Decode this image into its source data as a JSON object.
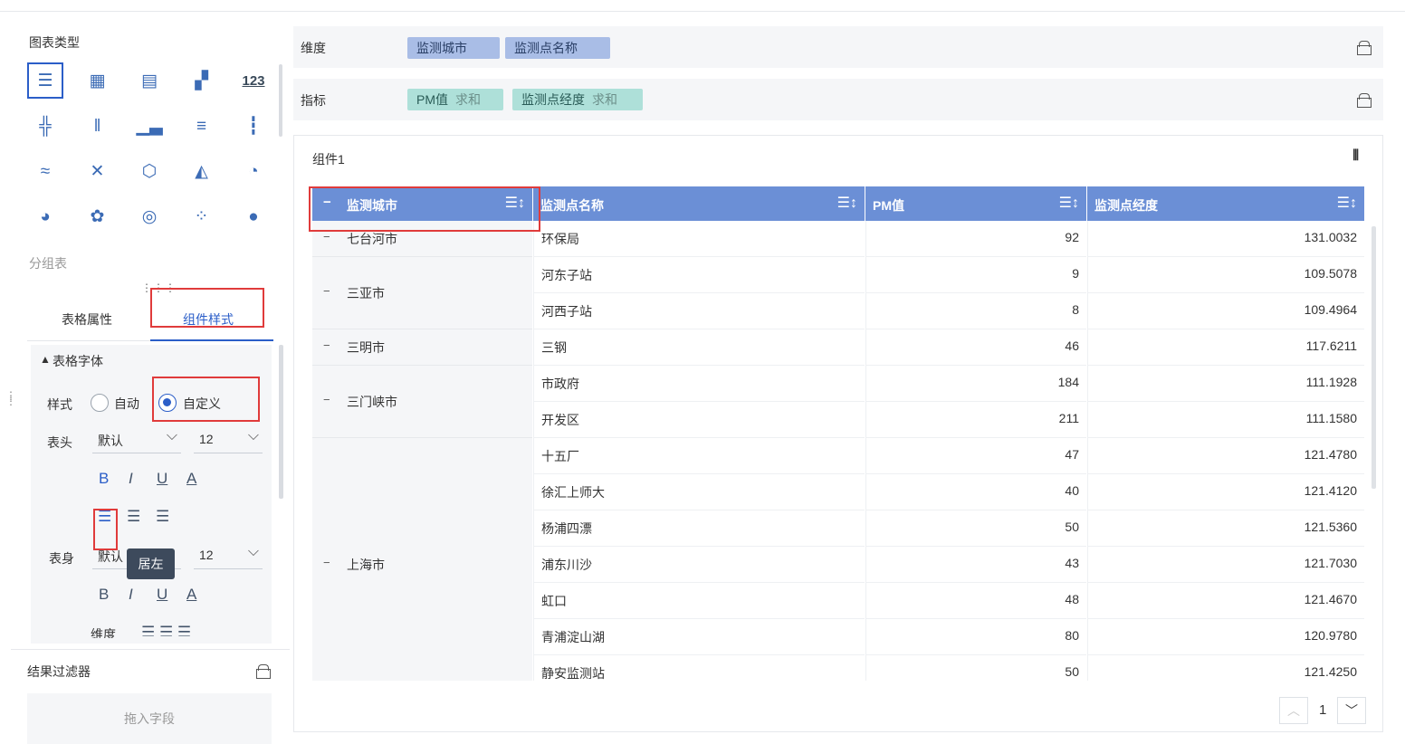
{
  "left": {
    "chart_type_title": "图表类型",
    "chart_icons": [
      {
        "icon": "grouped-table-icon",
        "glyph": "☰",
        "selected": true
      },
      {
        "icon": "cross-table-icon",
        "glyph": "▦"
      },
      {
        "icon": "detail-table-icon",
        "glyph": "▤"
      },
      {
        "icon": "dashboard-table-icon",
        "glyph": "▞"
      },
      {
        "icon": "kpi-number-icon",
        "glyph": "123"
      },
      {
        "icon": "stacked-bar-icon",
        "glyph": "╬"
      },
      {
        "icon": "multi-bar-icon",
        "glyph": "‖"
      },
      {
        "icon": "column-chart-icon",
        "glyph": "▁▃"
      },
      {
        "icon": "horizontal-bar-icon",
        "glyph": "≡"
      },
      {
        "icon": "diverging-bar-icon",
        "glyph": "┇"
      },
      {
        "icon": "line-wave-icon",
        "glyph": "≈"
      },
      {
        "icon": "cross-line-icon",
        "glyph": "✕"
      },
      {
        "icon": "radar-hex-icon",
        "glyph": "⬡"
      },
      {
        "icon": "area-chart-icon",
        "glyph": "◭"
      },
      {
        "icon": "gauge-icon",
        "glyph": "◔"
      },
      {
        "icon": "pie-chart-icon",
        "glyph": "◕"
      },
      {
        "icon": "rose-pie-icon",
        "glyph": "✿"
      },
      {
        "icon": "target-ring-icon",
        "glyph": "◎"
      },
      {
        "icon": "scatter-icon",
        "glyph": "⁘"
      },
      {
        "icon": "bubble-icon",
        "glyph": "●"
      }
    ],
    "chart_name": "分组表",
    "tabs": {
      "table_props": "表格属性",
      "component_style": "组件样式"
    },
    "font_section": "表格字体",
    "style_label": "样式",
    "auto_label": "自动",
    "custom_label": "自定义",
    "header_label": "表头",
    "body_label": "表身",
    "font_default": "默认",
    "font_size": "12",
    "format": {
      "bold": "B",
      "italic": "I",
      "underline": "U",
      "color": "A"
    },
    "tooltip": "居左",
    "dimension_label_partial": "维度",
    "filter_title": "结果过滤器",
    "drop_placeholder": "拖入字段"
  },
  "right": {
    "dimension_label": "维度",
    "dimensions": [
      "监测城市",
      "监测点名称"
    ],
    "metric_label": "指标",
    "metrics": [
      {
        "name": "PM值",
        "agg": "求和"
      },
      {
        "name": "监测点经度",
        "agg": "求和"
      }
    ],
    "widget_title": "组件1",
    "table": {
      "columns": [
        "监测城市",
        "监测点名称",
        "PM值",
        "监测点经度"
      ],
      "groups": [
        {
          "city": "七台河市",
          "rows": [
            [
              "环保局",
              "92",
              "131.0032"
            ]
          ]
        },
        {
          "city": "三亚市",
          "rows": [
            [
              "河东子站",
              "9",
              "109.5078"
            ],
            [
              "河西子站",
              "8",
              "109.4964"
            ]
          ]
        },
        {
          "city": "三明市",
          "rows": [
            [
              "三钢",
              "46",
              "117.6211"
            ]
          ]
        },
        {
          "city": "三门峡市",
          "rows": [
            [
              "市政府",
              "184",
              "111.1928"
            ],
            [
              "开发区",
              "211",
              "111.1580"
            ]
          ]
        },
        {
          "city": "上海市",
          "rows": [
            [
              "十五厂",
              "47",
              "121.4780"
            ],
            [
              "徐汇上师大",
              "40",
              "121.4120"
            ],
            [
              "杨浦四漂",
              "50",
              "121.5360"
            ],
            [
              "浦东川沙",
              "43",
              "121.7030"
            ],
            [
              "虹口",
              "48",
              "121.4670"
            ],
            [
              "青浦淀山湖",
              "80",
              "120.9780"
            ],
            [
              "静安监测站",
              "50",
              "121.4250"
            ]
          ]
        }
      ]
    },
    "page": "1"
  }
}
